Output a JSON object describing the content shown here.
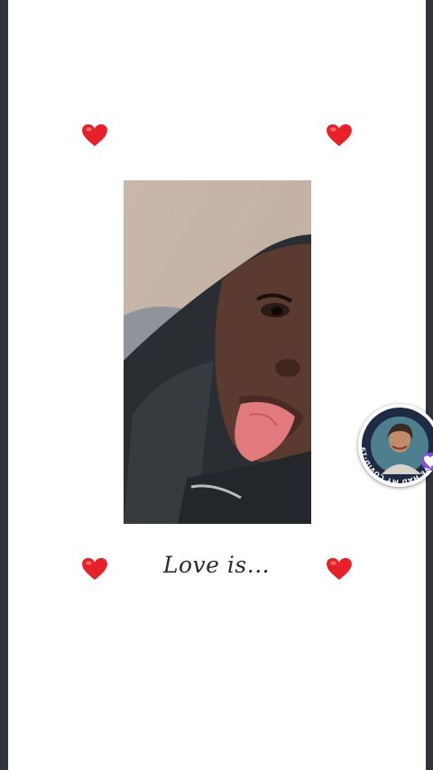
{
  "story": {
    "caption": "Love is...",
    "heart_icon": "red-heart-icon",
    "colors": {
      "background": "#2f353b",
      "card": "#ffffff",
      "heart": "#e8202a"
    }
  },
  "profile_badge": {
    "frame_text": "I'VE HAD MY COVID-19 VACCINE",
    "icon": "heart-badge-icon",
    "frame_color": "#1f2a44",
    "accent_color": "#8a4fd6"
  }
}
